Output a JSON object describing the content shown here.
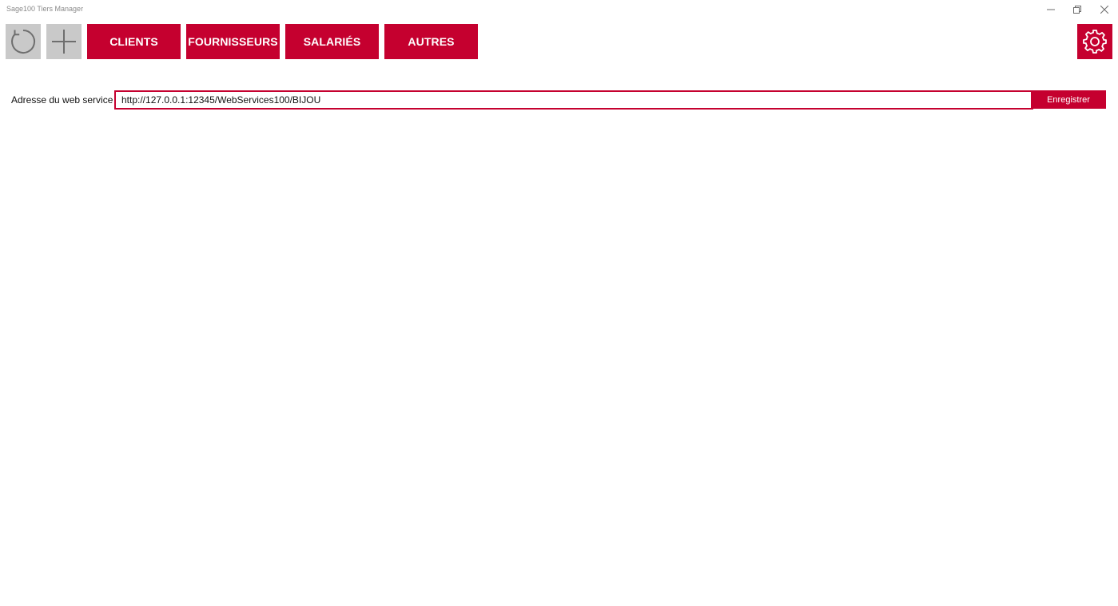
{
  "window": {
    "title": "Sage100 Tiers Manager"
  },
  "toolbar": {
    "refresh_icon": "refresh-icon",
    "add_icon": "plus-icon",
    "nav": {
      "clients": "CLIENTS",
      "fournisseurs": "FOURNISSEURS",
      "salaries": "SALARIÉS",
      "autres": "AUTRES"
    },
    "settings_icon": "gear-icon"
  },
  "webservice": {
    "label": "Adresse du web service :",
    "value": "http://127.0.0.1:12345/WebServices100/BIJOU",
    "save_label": "Enregistrer"
  },
  "colors": {
    "accent": "#c5002f",
    "neutral_button": "#c9c9c9"
  }
}
